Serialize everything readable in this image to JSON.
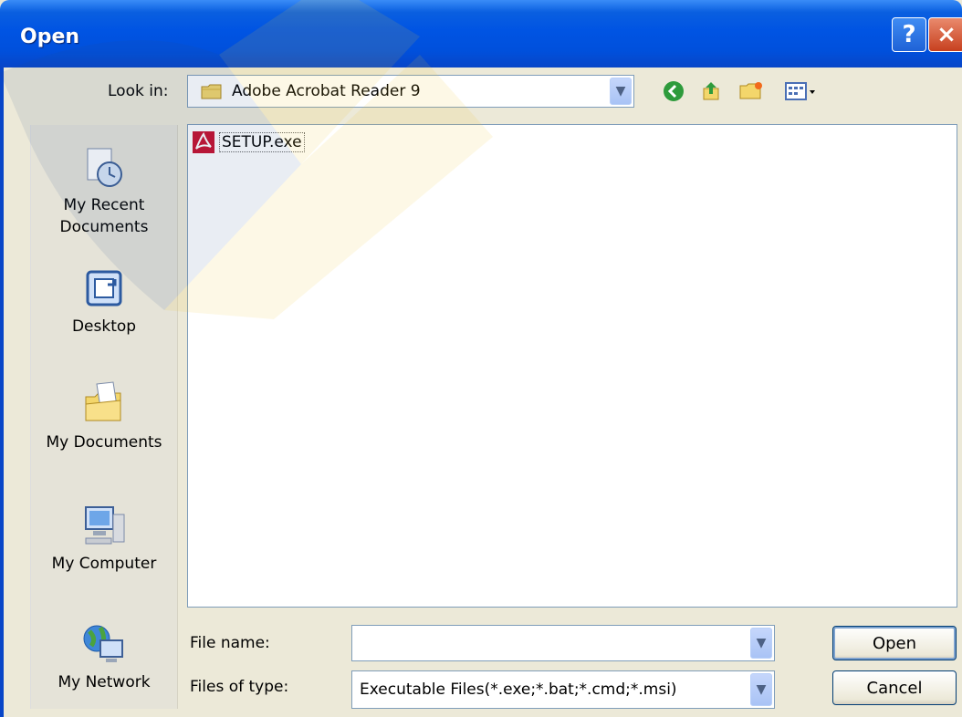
{
  "window": {
    "title": "Open",
    "help_glyph": "?",
    "close_glyph": "×"
  },
  "look_in": {
    "label": "Look in:",
    "value": "Adobe Acrobat Reader 9"
  },
  "toolbar": [
    "back-icon",
    "up-folder-icon",
    "new-folder-icon",
    "view-menu-icon"
  ],
  "places": [
    {
      "label": "My Recent Documents",
      "icon": "recent-documents-icon"
    },
    {
      "label": "Desktop",
      "icon": "desktop-icon"
    },
    {
      "label": "My Documents",
      "icon": "my-documents-icon"
    },
    {
      "label": "My Computer",
      "icon": "my-computer-icon"
    },
    {
      "label": "My Network",
      "icon": "my-network-icon"
    }
  ],
  "files": [
    {
      "name": "SETUP.exe",
      "icon": "pdf-exe-icon"
    }
  ],
  "file_name": {
    "label": "File name:",
    "value": ""
  },
  "files_of_type": {
    "label": "Files of type:",
    "value": "Executable Files(*.exe;*.bat;*.cmd;*.msi)"
  },
  "buttons": {
    "open": "Open",
    "cancel": "Cancel"
  },
  "colors": {
    "title_bar": "#0054e3",
    "dialog_bg": "#ece9d8",
    "list_border": "#7f9db9"
  }
}
